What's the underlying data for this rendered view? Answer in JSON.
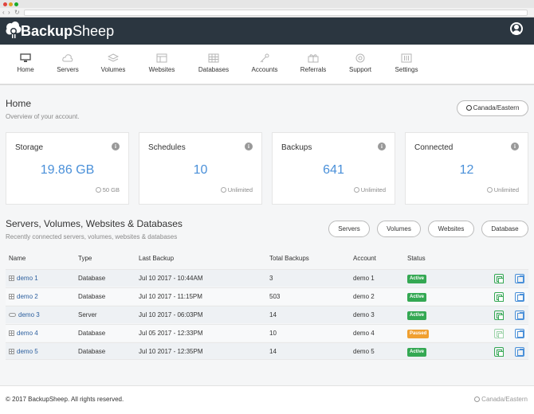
{
  "brand": {
    "name_bold": "Backup",
    "name_light": "Sheep"
  },
  "nav": [
    {
      "label": "Home",
      "icon": "monitor-icon"
    },
    {
      "label": "Servers",
      "icon": "cloud-icon"
    },
    {
      "label": "Volumes",
      "icon": "layers-icon"
    },
    {
      "label": "Websites",
      "icon": "browser-icon"
    },
    {
      "label": "Databases",
      "icon": "grid-icon"
    },
    {
      "label": "Accounts",
      "icon": "key-icon"
    },
    {
      "label": "Referrals",
      "icon": "gift-icon"
    },
    {
      "label": "Support",
      "icon": "lifebuoy-icon"
    },
    {
      "label": "Settings",
      "icon": "sliders-icon"
    }
  ],
  "page": {
    "title": "Home",
    "subtitle": "Overview of your account.",
    "timezone": "Canada/Eastern"
  },
  "cards": [
    {
      "title": "Storage",
      "value": "19.86 GB",
      "foot": "50 GB"
    },
    {
      "title": "Schedules",
      "value": "10",
      "foot": "Unlimited"
    },
    {
      "title": "Backups",
      "value": "641",
      "foot": "Unlimited"
    },
    {
      "title": "Connected",
      "value": "12",
      "foot": "Unlimited"
    }
  ],
  "section": {
    "title": "Servers, Volumes, Websites & Databases",
    "subtitle": "Recently connected servers, volumes, websites & databases",
    "filters": [
      "Servers",
      "Volumes",
      "Websites",
      "Database"
    ]
  },
  "table": {
    "headers": [
      "Name",
      "Type",
      "Last Backup",
      "Total Backups",
      "Account",
      "Status"
    ],
    "rows": [
      {
        "name": "demo 1",
        "type": "Database",
        "last": "Jul 10 2017 - 10:44AM",
        "total": "3",
        "account": "demo 1",
        "status": "Active"
      },
      {
        "name": "demo 2",
        "type": "Database",
        "last": "Jul 10 2017 - 11:15PM",
        "total": "503",
        "account": "demo 2",
        "status": "Active"
      },
      {
        "name": "demo 3",
        "type": "Server",
        "last": "Jul 10 2017 - 06:03PM",
        "total": "14",
        "account": "demo 3",
        "status": "Active"
      },
      {
        "name": "demo 4",
        "type": "Database",
        "last": "Jul 05 2017 - 12:33PM",
        "total": "10",
        "account": "demo 4",
        "status": "Paused"
      },
      {
        "name": "demo 5",
        "type": "Database",
        "last": "Jul 10 2017 - 12:35PM",
        "total": "14",
        "account": "demo 5",
        "status": "Active"
      }
    ]
  },
  "footer": {
    "copyright": "© 2017 BackupSheep. All rights reserved.",
    "timezone": "Canada/Eastern"
  },
  "colors": {
    "header_bg": "#2b3640",
    "accent": "#4a90d9",
    "active": "#34a853",
    "paused": "#f0a030"
  }
}
